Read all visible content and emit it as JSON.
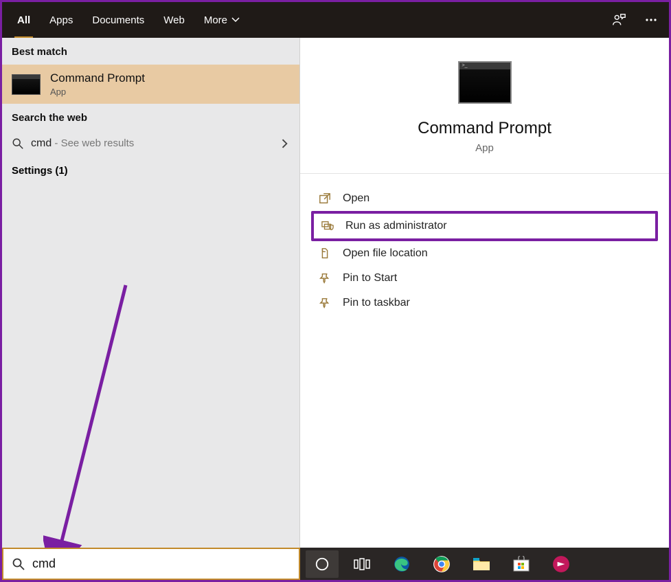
{
  "header": {
    "tabs": [
      {
        "label": "All",
        "active": true
      },
      {
        "label": "Apps"
      },
      {
        "label": "Documents"
      },
      {
        "label": "Web"
      },
      {
        "label": "More",
        "dropdown": true
      }
    ]
  },
  "left": {
    "best_match_label": "Best match",
    "best_match": {
      "title": "Command Prompt",
      "subtitle": "App"
    },
    "search_web_label": "Search the web",
    "web": {
      "query": "cmd",
      "hint": " - See web results"
    },
    "settings_label": "Settings (1)"
  },
  "preview": {
    "title": "Command Prompt",
    "subtitle": "App"
  },
  "actions": [
    {
      "icon": "open",
      "label": "Open",
      "highlight": false
    },
    {
      "icon": "admin",
      "label": "Run as administrator",
      "highlight": true
    },
    {
      "icon": "folder",
      "label": "Open file location",
      "highlight": false
    },
    {
      "icon": "pin-start",
      "label": "Pin to Start",
      "highlight": false
    },
    {
      "icon": "pin-taskbar",
      "label": "Pin to taskbar",
      "highlight": false
    }
  ],
  "search": {
    "value": "cmd"
  },
  "colors": {
    "accent": "#7a1fa2",
    "gold": "#c28a2a"
  }
}
